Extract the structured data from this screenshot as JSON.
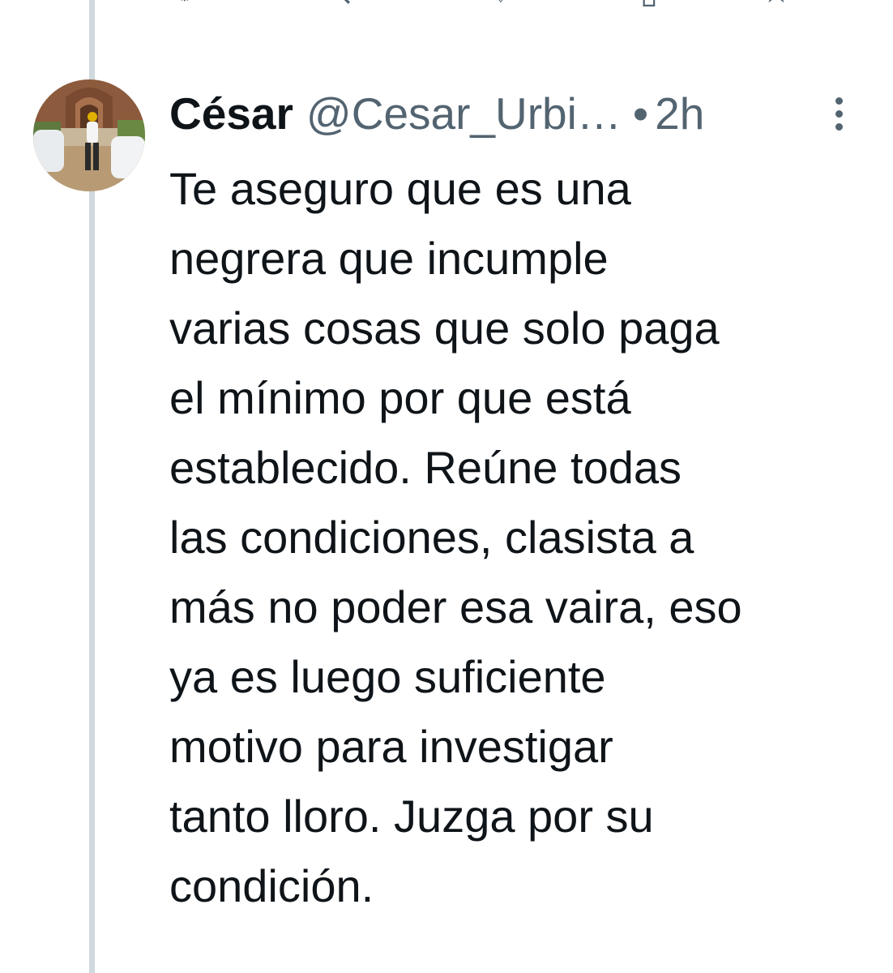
{
  "tweet": {
    "author": {
      "display_name": "César",
      "handle": "@Cesar_Urbi…"
    },
    "separator": "•",
    "time": "2h",
    "text": "Te aseguro que es una\nnegrera que incumple\nvarias cosas que solo paga\nel mínimo por que está\nestablecido. Reúne todas\nlas condiciones, clasista a\nmás no poder esa vaira, eso\nya es luego suficiente\nmotivo para investigar\ntanto lloro. Juzga por su\ncondición."
  },
  "icons": {
    "more": "more-options-icon",
    "thread": "thread-line"
  },
  "colors": {
    "text_primary": "#0f1419",
    "text_secondary": "#536471",
    "thread_line": "#cfd9de"
  }
}
